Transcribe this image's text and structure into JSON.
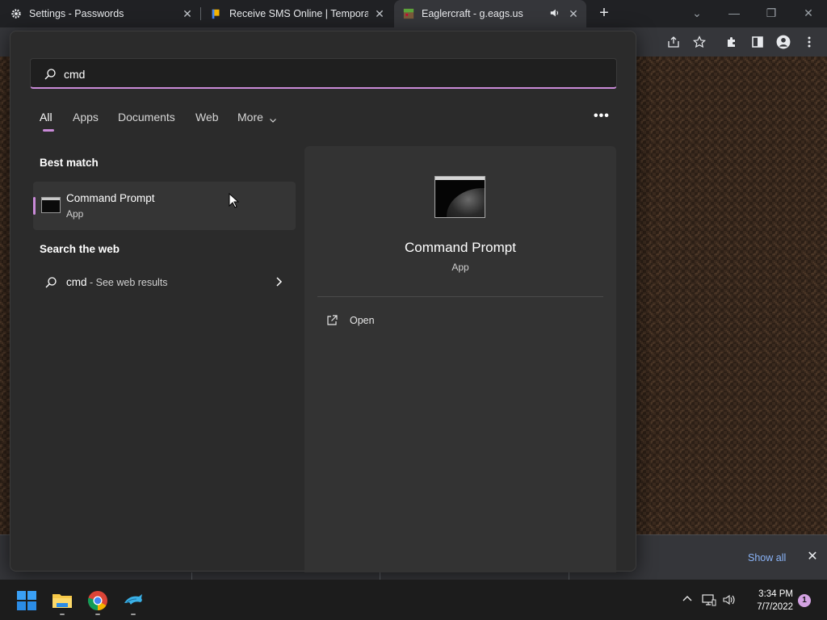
{
  "browser": {
    "tabs": [
      {
        "title": "Settings - Passwords",
        "icon": "gear-icon",
        "close": "✕"
      },
      {
        "title": "Receive SMS Online | Temporary",
        "icon": "bookmark-flag-icon",
        "close": "✕"
      },
      {
        "title": "Eaglercraft - g.eags.us",
        "icon": "minecraft-icon",
        "close": "✕",
        "audio": "speaker-icon"
      }
    ],
    "new_tab": "+",
    "window_controls": {
      "tabsearch": "⌄",
      "minimize": "—",
      "restore": "❐",
      "close": "✕"
    }
  },
  "download_bar": {
    "show_all": "Show all",
    "close": "✕"
  },
  "start_search": {
    "query": "cmd",
    "filters": [
      "All",
      "Apps",
      "Documents",
      "Web",
      "More"
    ],
    "active_filter": "All",
    "more_dots": "•••",
    "best_match_title": "Best match",
    "best_match": {
      "name": "Command Prompt",
      "type": "App"
    },
    "search_web_title": "Search the web",
    "web_result": {
      "query": "cmd",
      "suffix": " - See web results"
    },
    "detail": {
      "name": "Command Prompt",
      "type": "App",
      "actions": [
        {
          "label": "Open",
          "icon": "open-external-icon"
        }
      ]
    },
    "accent_color": "#c98ad8"
  },
  "taskbar": {
    "apps": [
      "windows-start-icon",
      "file-explorer-icon",
      "chrome-icon",
      "dolphin-icon"
    ],
    "clock_time": "3:34 PM",
    "clock_date": "7/7/2022",
    "notification_count": "1"
  }
}
